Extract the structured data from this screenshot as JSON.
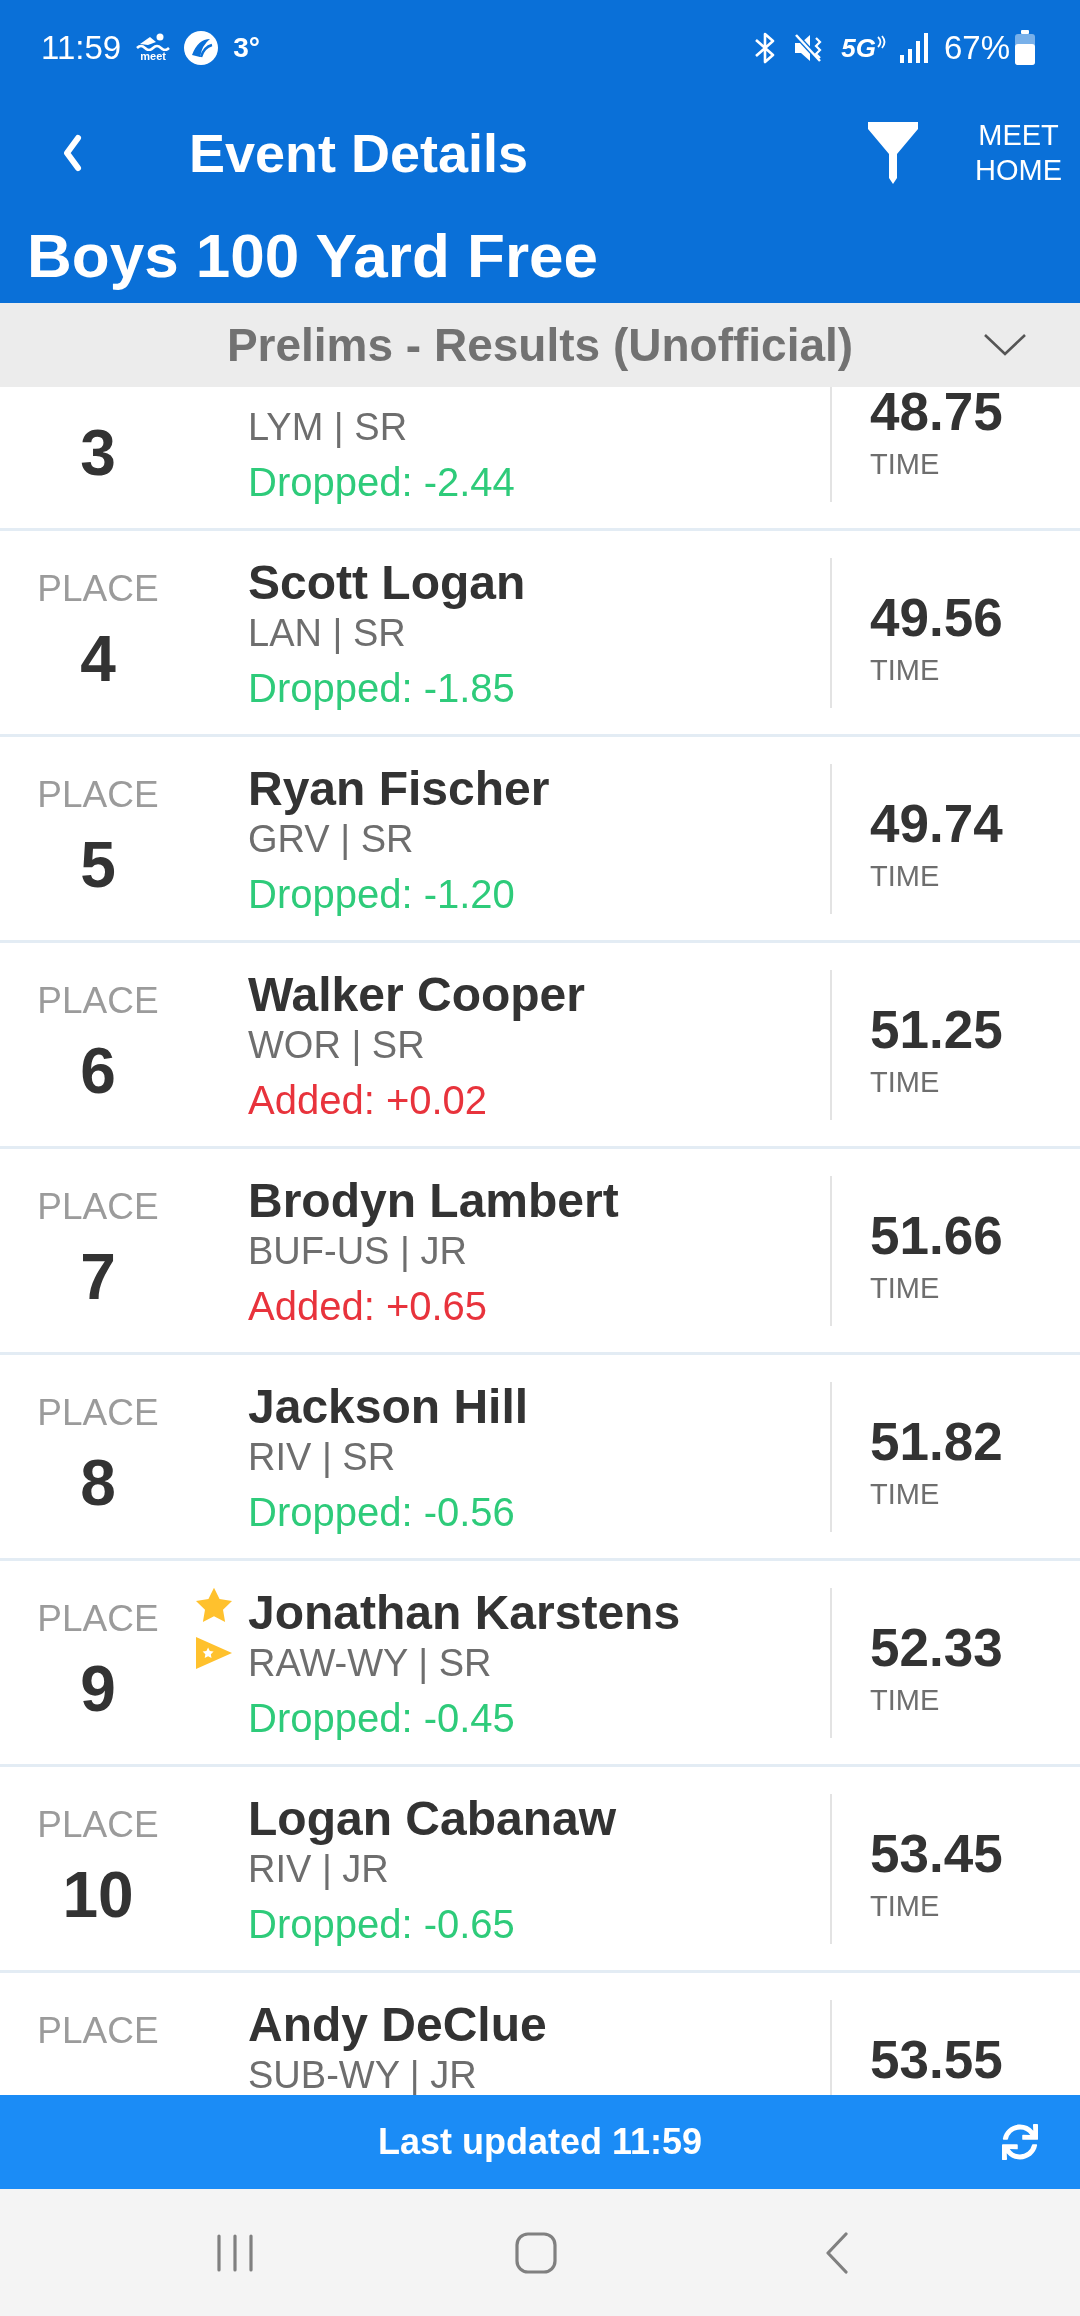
{
  "status_bar": {
    "time": "11:59",
    "app_icon_label": "meet",
    "temperature": "3°",
    "network": "5G",
    "battery": "67%"
  },
  "header": {
    "title": "Event Details",
    "meet_home_button": "MEET HOME"
  },
  "event": {
    "name": "Boys 100 Yard Free"
  },
  "round_selector": {
    "label": "Prelims - Results (Unofficial)"
  },
  "results": [
    {
      "place": "3",
      "team": "LYM | SR",
      "delta": {
        "kind": "dropped",
        "text": "Dropped: -2.44"
      },
      "time": "48.75",
      "time_label": "TIME"
    },
    {
      "place_label": "PLACE",
      "place": "4",
      "name": "Scott Logan",
      "team": "LAN | SR",
      "delta": {
        "kind": "dropped",
        "text": "Dropped: -1.85"
      },
      "time": "49.56",
      "time_label": "TIME"
    },
    {
      "place_label": "PLACE",
      "place": "5",
      "name": "Ryan Fischer",
      "team": "GRV | SR",
      "delta": {
        "kind": "dropped",
        "text": "Dropped: -1.20"
      },
      "time": "49.74",
      "time_label": "TIME"
    },
    {
      "place_label": "PLACE",
      "place": "6",
      "name": "Walker Cooper",
      "team": "WOR | SR",
      "delta": {
        "kind": "added",
        "text": "Added: +0.02"
      },
      "time": "51.25",
      "time_label": "TIME"
    },
    {
      "place_label": "PLACE",
      "place": "7",
      "name": "Brodyn Lambert",
      "team": "BUF-US | JR",
      "delta": {
        "kind": "added",
        "text": "Added: +0.65"
      },
      "time": "51.66",
      "time_label": "TIME"
    },
    {
      "place_label": "PLACE",
      "place": "8",
      "name": "Jackson Hill",
      "team": "RIV | SR",
      "delta": {
        "kind": "dropped",
        "text": "Dropped: -0.56"
      },
      "time": "51.82",
      "time_label": "TIME"
    },
    {
      "place_label": "PLACE",
      "place": "9",
      "marks": [
        {
          "kind": "star"
        },
        {
          "kind": "pennant"
        }
      ],
      "name": "Jonathan Karstens",
      "team": "RAW-WY | SR",
      "delta": {
        "kind": "dropped",
        "text": "Dropped: -0.45"
      },
      "time": "52.33",
      "time_label": "TIME"
    },
    {
      "place_label": "PLACE",
      "place": "10",
      "name": "Logan Cabanaw",
      "team": "RIV | JR",
      "delta": {
        "kind": "dropped",
        "text": "Dropped: -0.65"
      },
      "time": "53.45",
      "time_label": "TIME"
    },
    {
      "place_label": "PLACE",
      "name": "Andy DeClue",
      "team": "SUB-WY | JR",
      "time": "53.55"
    }
  ],
  "footer": {
    "last_updated": "Last updated 11:59"
  }
}
